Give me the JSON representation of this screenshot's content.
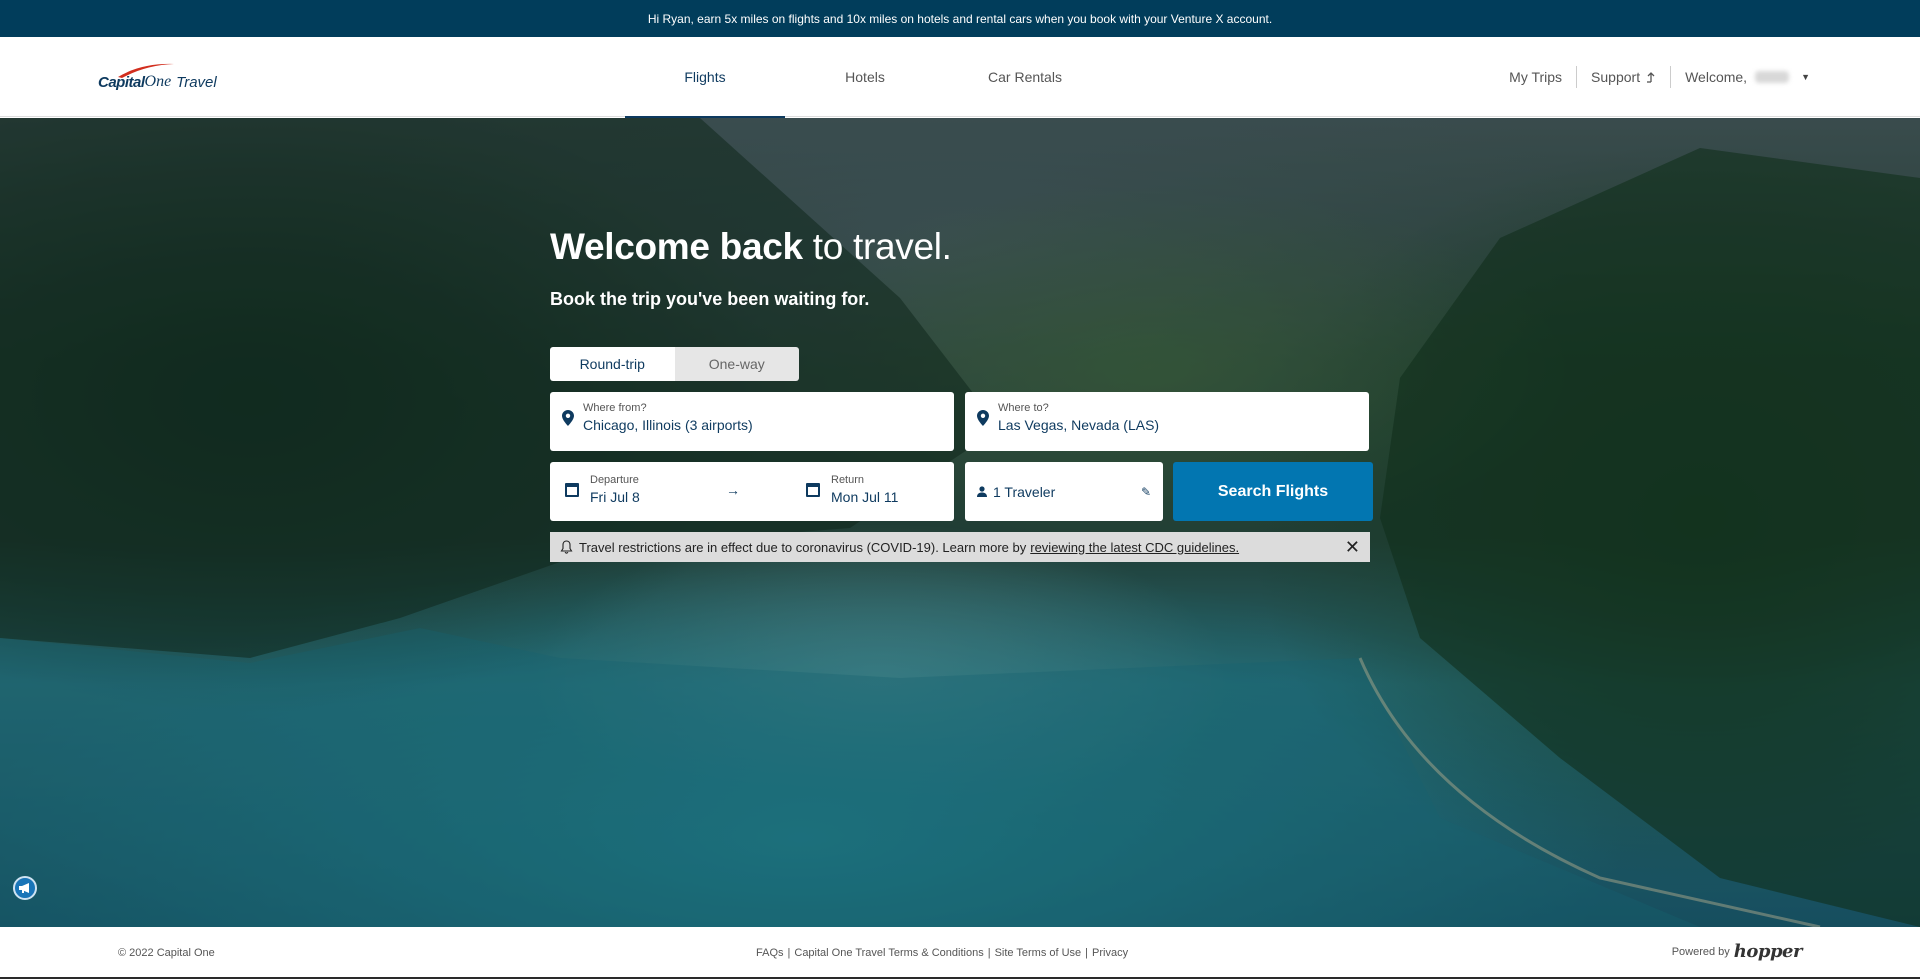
{
  "promo_bar": {
    "text": "Hi Ryan, earn 5x miles on flights and 10x miles on hotels and rental cars when you book with your Venture X account."
  },
  "header": {
    "logo": {
      "capital": "Capital",
      "one": "One",
      "travel": "Travel"
    },
    "tabs": [
      {
        "label": "Flights",
        "active": true
      },
      {
        "label": "Hotels",
        "active": false
      },
      {
        "label": "Car Rentals",
        "active": false
      }
    ],
    "right_nav": {
      "my_trips": "My Trips",
      "support": "Support",
      "welcome": "Welcome,"
    }
  },
  "hero": {
    "title_bold": "Welcome back",
    "title_light": " to travel.",
    "subtitle": "Book the trip you've been waiting for."
  },
  "search": {
    "trip_types": [
      {
        "label": "Round-trip",
        "active": true
      },
      {
        "label": "One-way",
        "active": false
      }
    ],
    "from": {
      "label": "Where from?",
      "value": "Chicago, Illinois (3 airports)"
    },
    "to": {
      "label": "Where to?",
      "value": "Las Vegas, Nevada (LAS)"
    },
    "departure": {
      "label": "Departure",
      "value": "Fri Jul 8"
    },
    "return": {
      "label": "Return",
      "value": "Mon Jul 11"
    },
    "travelers": {
      "value": "1 Traveler"
    },
    "search_button": "Search Flights"
  },
  "covid_banner": {
    "text": "Travel restrictions are in effect due to coronavirus (COVID-19). Learn more by",
    "link": "reviewing the latest CDC guidelines.",
    "close": "✕"
  },
  "footer": {
    "copyright": "© 2022 Capital One",
    "links": [
      "FAQs",
      "Capital One Travel Terms & Conditions",
      "Site Terms of Use",
      "Privacy"
    ],
    "separator": "|",
    "powered_by": "Powered by",
    "partner": "hopper"
  },
  "colors": {
    "promo_bg": "#013d5b",
    "brand_navy": "#0e3a5f",
    "search_button": "#0276b1",
    "banner_bg": "#dcdcdc"
  }
}
